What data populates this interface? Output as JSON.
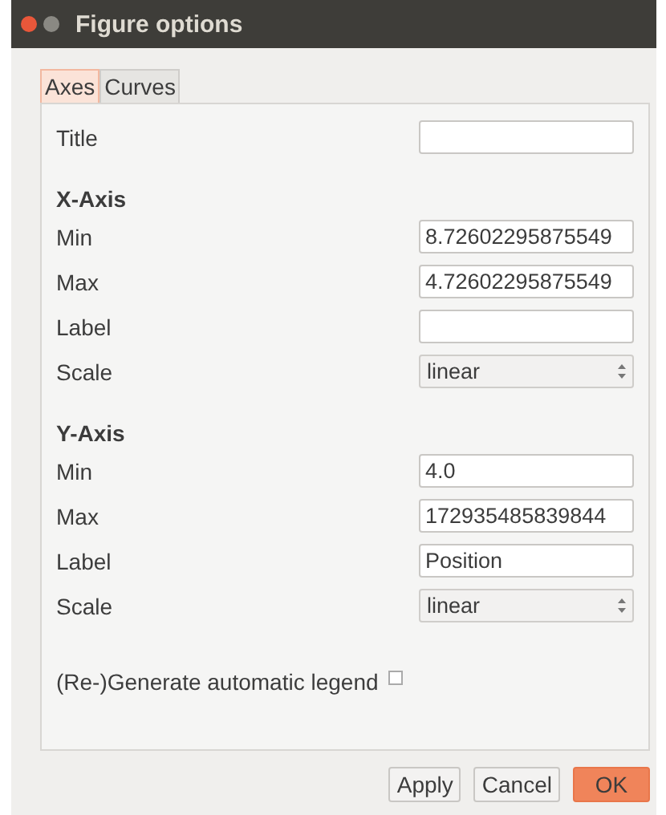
{
  "window": {
    "title": "Figure options"
  },
  "tabs": [
    {
      "label": "Axes",
      "selected": true
    },
    {
      "label": "Curves",
      "selected": false
    }
  ],
  "sections": [
    {
      "kind": "plain",
      "rows": [
        {
          "kind": "text",
          "label": "Title",
          "value": ""
        }
      ]
    },
    {
      "kind": "group",
      "heading": "X-Axis",
      "rows": [
        {
          "kind": "text",
          "label": "Min",
          "value": "8.72602295875549"
        },
        {
          "kind": "text",
          "label": "Max",
          "value": "4.72602295875549"
        },
        {
          "kind": "text",
          "label": "Label",
          "value": ""
        },
        {
          "kind": "select",
          "label": "Scale",
          "value": "linear"
        }
      ]
    },
    {
      "kind": "group",
      "heading": "Y-Axis",
      "rows": [
        {
          "kind": "text",
          "label": "Min",
          "value": "4.0"
        },
        {
          "kind": "text",
          "label": "Max",
          "value": "172935485839844"
        },
        {
          "kind": "text",
          "label": "Label",
          "value": "Position"
        },
        {
          "kind": "select",
          "label": "Scale",
          "value": "linear"
        }
      ]
    }
  ],
  "legend_option": {
    "label": "(Re-)Generate automatic legend",
    "checked": false
  },
  "buttons": [
    {
      "label": "Apply",
      "default": false
    },
    {
      "label": "Cancel",
      "default": false
    },
    {
      "label": "OK",
      "default": true
    }
  ]
}
